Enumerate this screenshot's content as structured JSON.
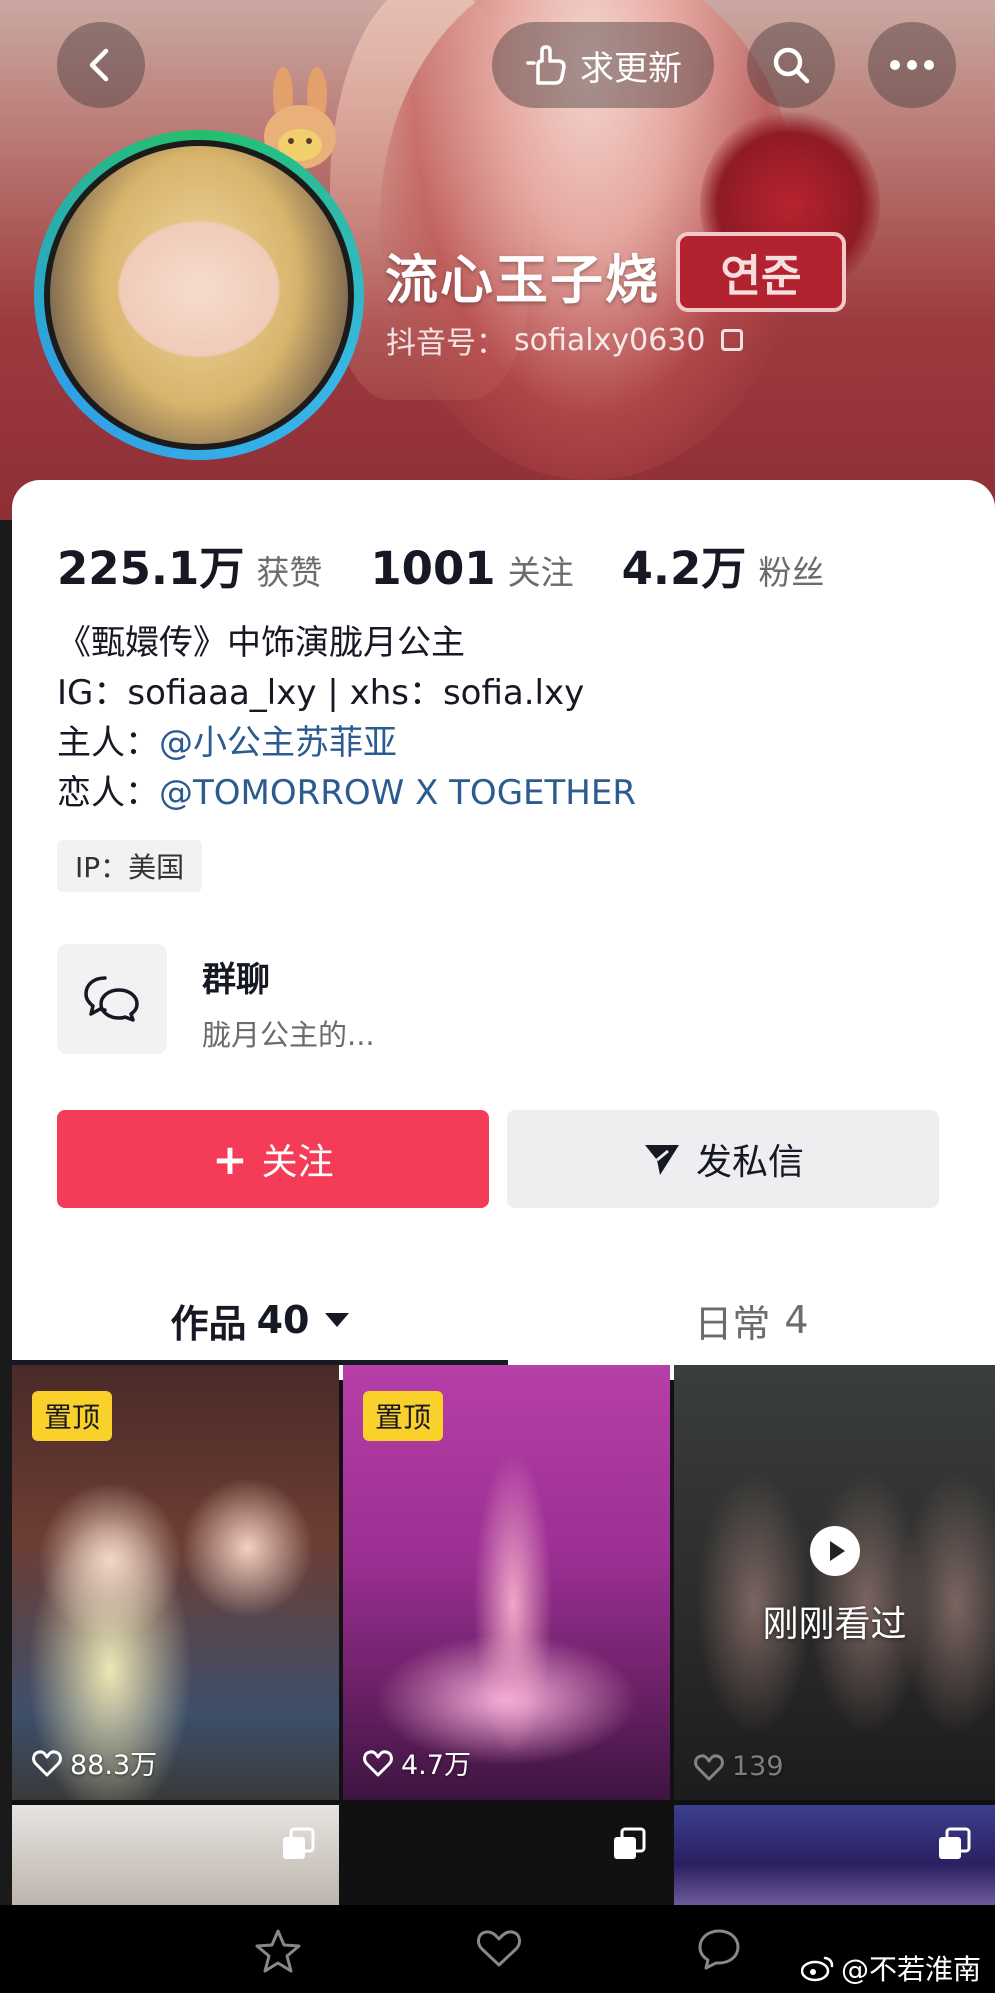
{
  "header": {
    "update_label": "求更新",
    "name": "流心玉子烧",
    "name_sticker": "연준",
    "id_label": "抖音号：",
    "id_value": "sofialxy0630"
  },
  "stats": [
    {
      "value": "225.1万",
      "label": "获赞"
    },
    {
      "value": "1001",
      "label": "关注"
    },
    {
      "value": "4.2万",
      "label": "粉丝"
    }
  ],
  "bio": {
    "line1": "《甄嬛传》中饰演胧月公主",
    "line2": "IG：sofiaaa_lxy | xhs：sofia.lxy",
    "line3_prefix": "主人：",
    "line3_mention": "@小公主苏菲亚",
    "line4_prefix": "恋人：",
    "line4_mention": "@TOMORROW X TOGETHER"
  },
  "ip_tag": "IP：美国",
  "group_chat": {
    "title": "群聊",
    "desc": "胧月公主的..."
  },
  "buttons": {
    "follow": "关注",
    "message": "发私信"
  },
  "tabs": {
    "works_label": "作品",
    "works_count": "40",
    "daily_label": "日常",
    "daily_count": "4"
  },
  "videos": [
    {
      "pin": "置顶",
      "likes": "88.3万"
    },
    {
      "pin": "置顶",
      "likes": "4.7万"
    },
    {
      "overlay": "刚刚看过",
      "likes": "139"
    }
  ],
  "watermark": "@不若淮南",
  "colors": {
    "follow_button": "#f43c59",
    "mention": "#2b5b91",
    "pin_badge": "#f9d12a"
  },
  "icons": [
    "back-icon",
    "hand-point-icon",
    "search-icon",
    "more-icon",
    "copy-icon",
    "chat-bubbles-icon",
    "plus-icon",
    "send-icon",
    "dropdown-triangle-icon",
    "heart-icon",
    "play-icon",
    "multi-image-icon",
    "star-icon",
    "weibo-icon"
  ]
}
